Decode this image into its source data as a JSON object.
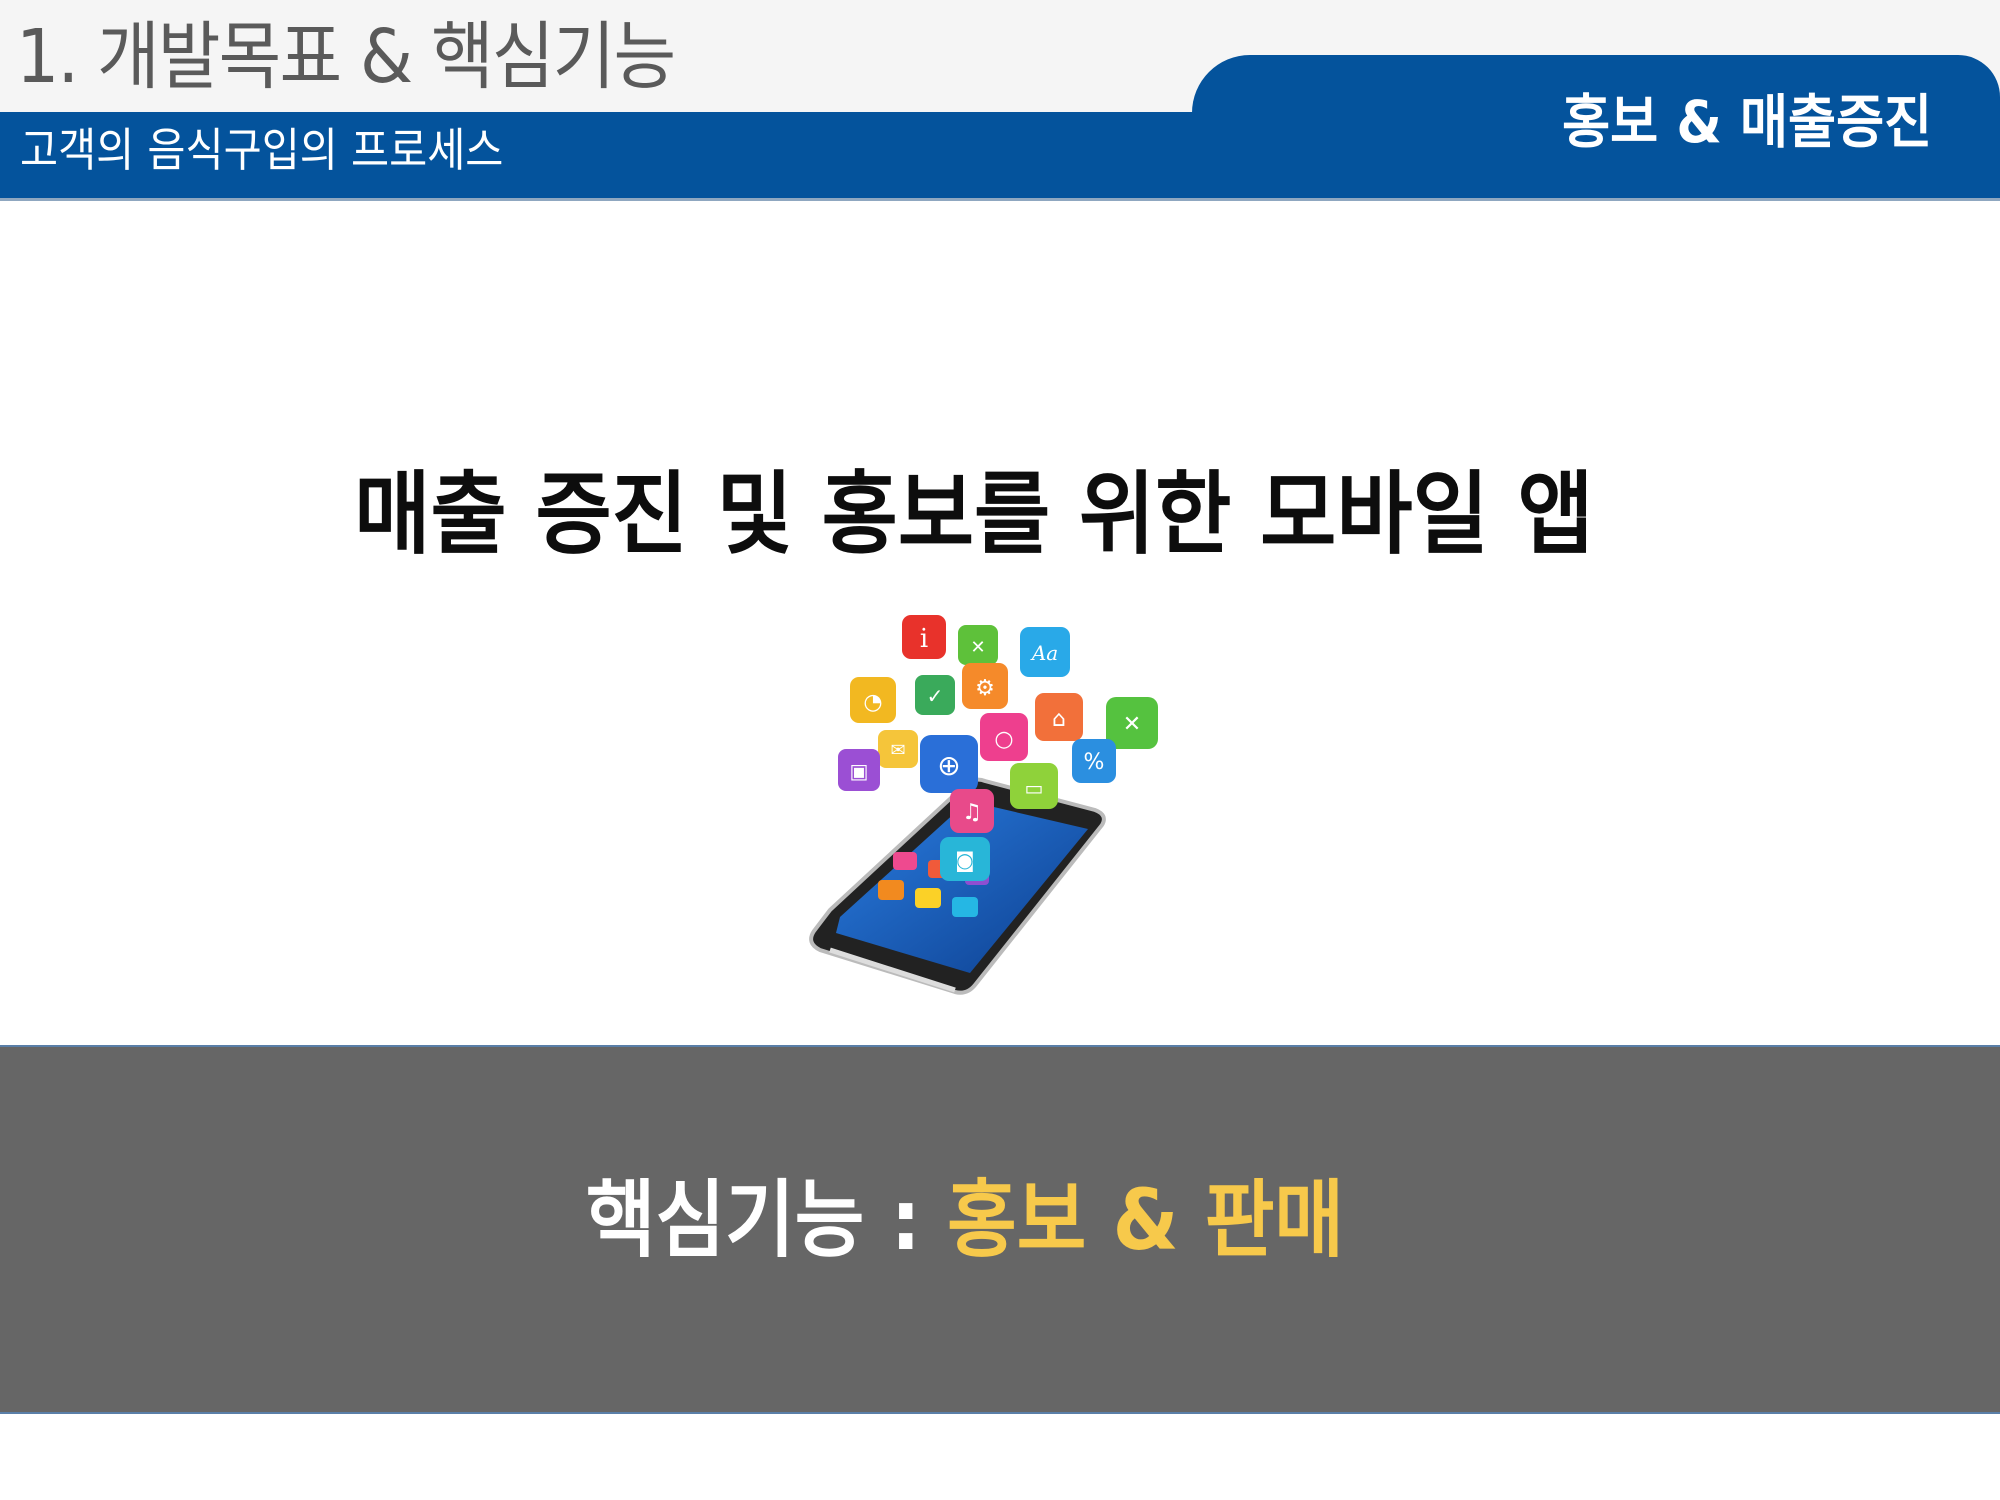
{
  "header": {
    "title": "1. 개발목표 & 핵심기능",
    "subtitle": "고객의 음식구입의 프로세스",
    "tab_label": "홍보 & 매출증진"
  },
  "main": {
    "heading": "매출 증진 및 홍보를 위한 모바일 앱"
  },
  "footer": {
    "label": "핵심기능 : ",
    "highlight": "홍보 & 판매"
  },
  "colors": {
    "header_blue": "#04539c",
    "footer_gray": "#666666",
    "highlight_yellow": "#f7c94b"
  },
  "illustration": {
    "icons": [
      "info-icon",
      "grid-icon",
      "font-icon",
      "rss-icon",
      "check-icon",
      "settings-icon",
      "unlock-icon",
      "shuffle-icon",
      "mail-icon",
      "globe-icon",
      "search-icon",
      "percent-icon",
      "lock-icon",
      "cart-icon",
      "music-icon",
      "camera-icon"
    ]
  }
}
